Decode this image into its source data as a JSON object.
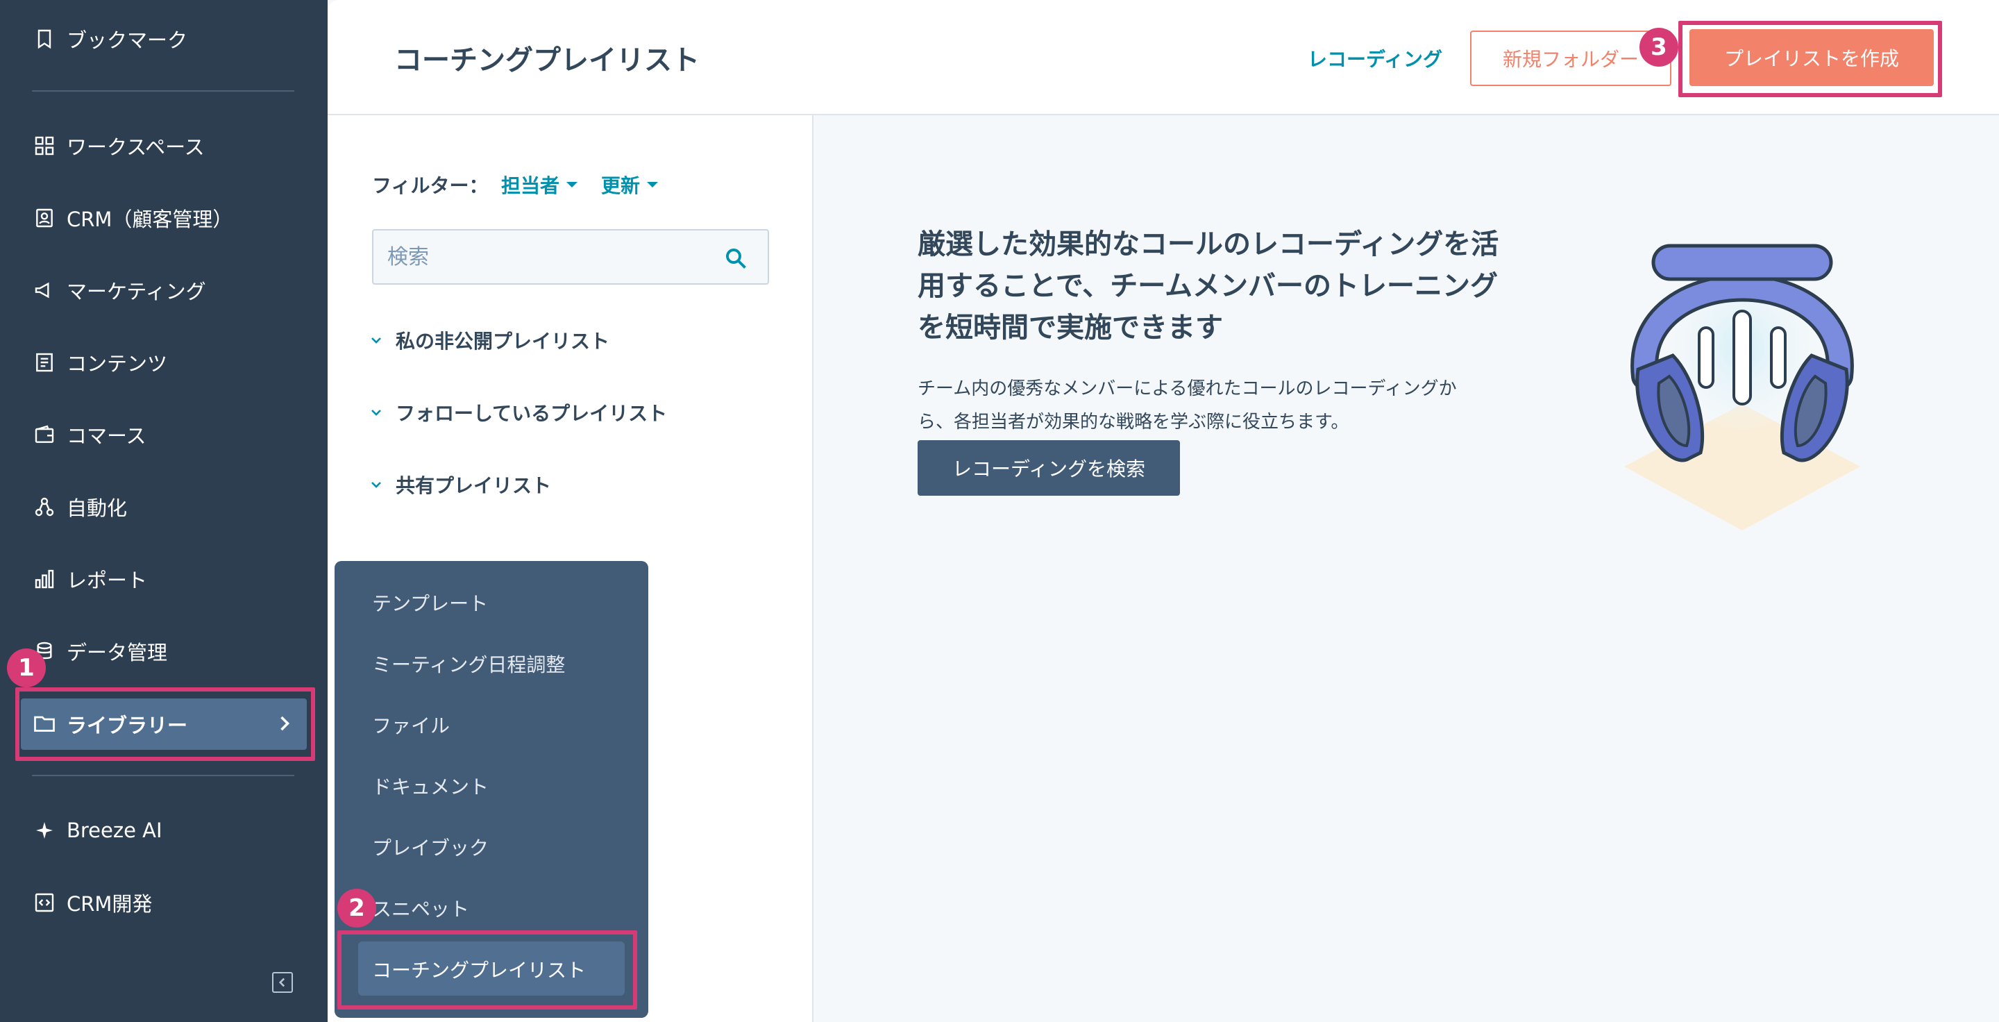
{
  "sidebar": {
    "items": [
      {
        "label": "ブックマーク",
        "icon": "bookmark-icon"
      },
      {
        "label": "ワークスペース",
        "icon": "grid-icon"
      },
      {
        "label": "CRM（顧客管理）",
        "icon": "contact-card-icon"
      },
      {
        "label": "マーケティング",
        "icon": "megaphone-icon"
      },
      {
        "label": "コンテンツ",
        "icon": "document-icon"
      },
      {
        "label": "コマース",
        "icon": "wallet-icon"
      },
      {
        "label": "自動化",
        "icon": "workflow-icon"
      },
      {
        "label": "レポート",
        "icon": "bar-chart-icon"
      },
      {
        "label": "データ管理",
        "icon": "database-icon"
      },
      {
        "label": "ライブラリー",
        "icon": "folder-icon"
      },
      {
        "label": "Breeze AI",
        "icon": "sparkle-icon"
      },
      {
        "label": "CRM開発",
        "icon": "code-icon"
      }
    ]
  },
  "submenu": {
    "items": [
      "テンプレート",
      "ミーティング日程調整",
      "ファイル",
      "ドキュメント",
      "プレイブック",
      "スニペット",
      "コーチングプレイリスト"
    ],
    "active_index": 6
  },
  "header": {
    "title": "コーチングプレイリスト",
    "recording_link": "レコーディング",
    "new_folder_button": "新規フォルダー",
    "create_button": "プレイリストを作成"
  },
  "filters": {
    "label": "フィルター：",
    "owner": "担当者",
    "updated": "更新"
  },
  "search": {
    "placeholder": "検索"
  },
  "sections": [
    "私の非公開プレイリスト",
    "フォローしているプレイリスト",
    "共有プレイリスト"
  ],
  "main": {
    "headline_lines": [
      "厳選した効果的なコールのレコーディングを活",
      "用することで、チームメンバーのトレーニング",
      "を短時間で実施できます"
    ],
    "description_lines": [
      "チーム内の優秀なメンバーによる優れたコールのレコーディングか",
      "ら、各担当者が効果的な戦略を学ぶ際に役立ちます。"
    ],
    "search_recordings_button": "レコーディングを検索"
  },
  "annotations": [
    "1",
    "2",
    "3"
  ],
  "colors": {
    "sidebar_bg": "#2d3e50",
    "accent_orange": "#f2826a",
    "link_teal": "#0091ae",
    "highlight_pink": "#d63b76"
  }
}
